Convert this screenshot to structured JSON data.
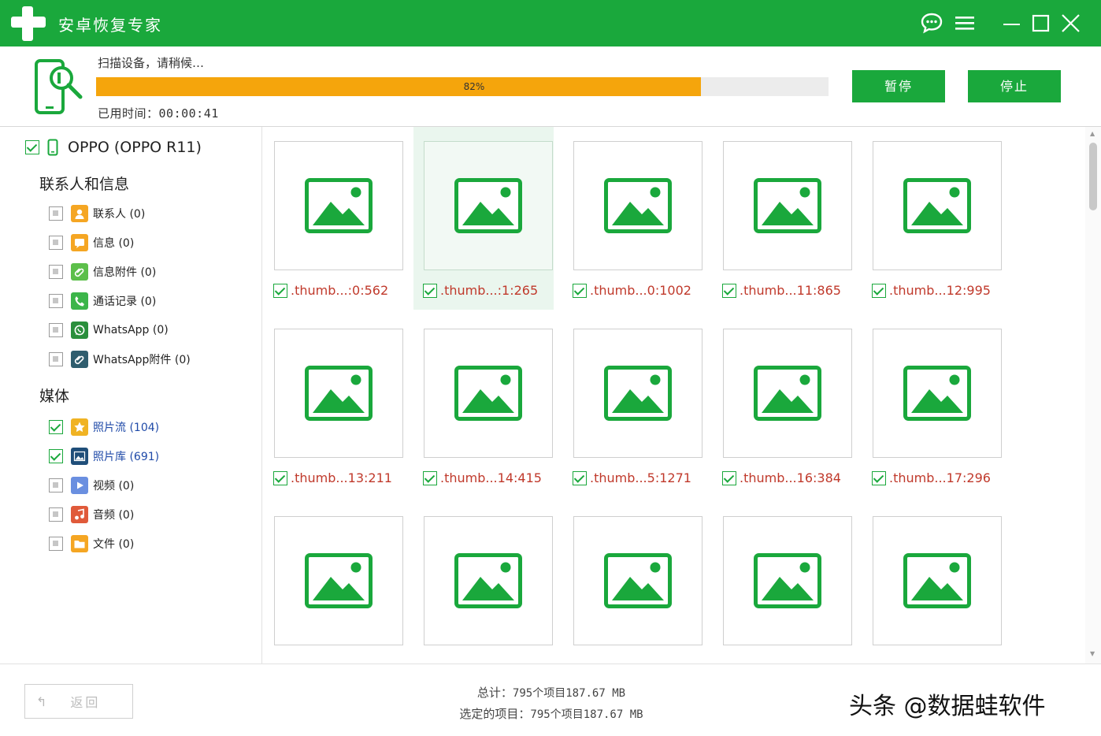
{
  "app": {
    "title": "安卓恢复专家"
  },
  "scan": {
    "status": "扫描设备，请稍候…",
    "progress_percent": 82,
    "progress_label": "82%",
    "elapsed_label": "已用时间：",
    "elapsed_value": "00:00:41",
    "pause_label": "暂停",
    "stop_label": "停止"
  },
  "device": {
    "name": "OPPO (OPPO R11)"
  },
  "sidebar": {
    "section_contacts": "联系人和信息",
    "section_media": "媒体",
    "contacts_items": [
      {
        "label": "联系人 (0)",
        "icon": "contact-icon",
        "color": "#f5a623"
      },
      {
        "label": "信息 (0)",
        "icon": "message-icon",
        "color": "#f5a623"
      },
      {
        "label": "信息附件 (0)",
        "icon": "attachment-icon",
        "color": "#5cbf4a"
      },
      {
        "label": "通话记录 (0)",
        "icon": "phone-call-icon",
        "color": "#3cb54a"
      },
      {
        "label": "WhatsApp (0)",
        "icon": "whatsapp-icon",
        "color": "#2a8f3c"
      },
      {
        "label": "WhatsApp附件 (0)",
        "icon": "whatsapp-attachment-icon",
        "color": "#2f5d6e"
      }
    ],
    "media_items": [
      {
        "label": "照片流 (104)",
        "icon": "photo-stream-icon",
        "color": "#f0b323",
        "checked": true
      },
      {
        "label": "照片库 (691)",
        "icon": "photo-library-icon",
        "color": "#1f4e79",
        "checked": true
      },
      {
        "label": "视频 (0)",
        "icon": "video-icon",
        "color": "#6a8fe0",
        "checked": false
      },
      {
        "label": "音频 (0)",
        "icon": "audio-icon",
        "color": "#e05a3a",
        "checked": false
      },
      {
        "label": "文件 (0)",
        "icon": "folder-icon",
        "color": "#f5a623",
        "checked": false
      }
    ]
  },
  "grid": {
    "accent": "#1aa83c",
    "items": [
      {
        "name": ".thumb...:0:562"
      },
      {
        "name": ".thumb...:1:265"
      },
      {
        "name": ".thumb...0:1002"
      },
      {
        "name": ".thumb...11:865"
      },
      {
        "name": ".thumb...12:995"
      },
      {
        "name": ".thumb...13:211"
      },
      {
        "name": ".thumb...14:415"
      },
      {
        "name": ".thumb...5:1271"
      },
      {
        "name": ".thumb...16:384"
      },
      {
        "name": ".thumb...17:296"
      },
      {
        "name": ""
      },
      {
        "name": ""
      },
      {
        "name": ""
      },
      {
        "name": ""
      },
      {
        "name": ""
      }
    ]
  },
  "footer": {
    "back_label": "返回",
    "total_label": "总计：",
    "total_value": "795个项目187.67 MB",
    "selected_label": "选定的项目：",
    "selected_value": "795个项目187.67 MB",
    "watermark": "头条 @数据蛙软件"
  }
}
